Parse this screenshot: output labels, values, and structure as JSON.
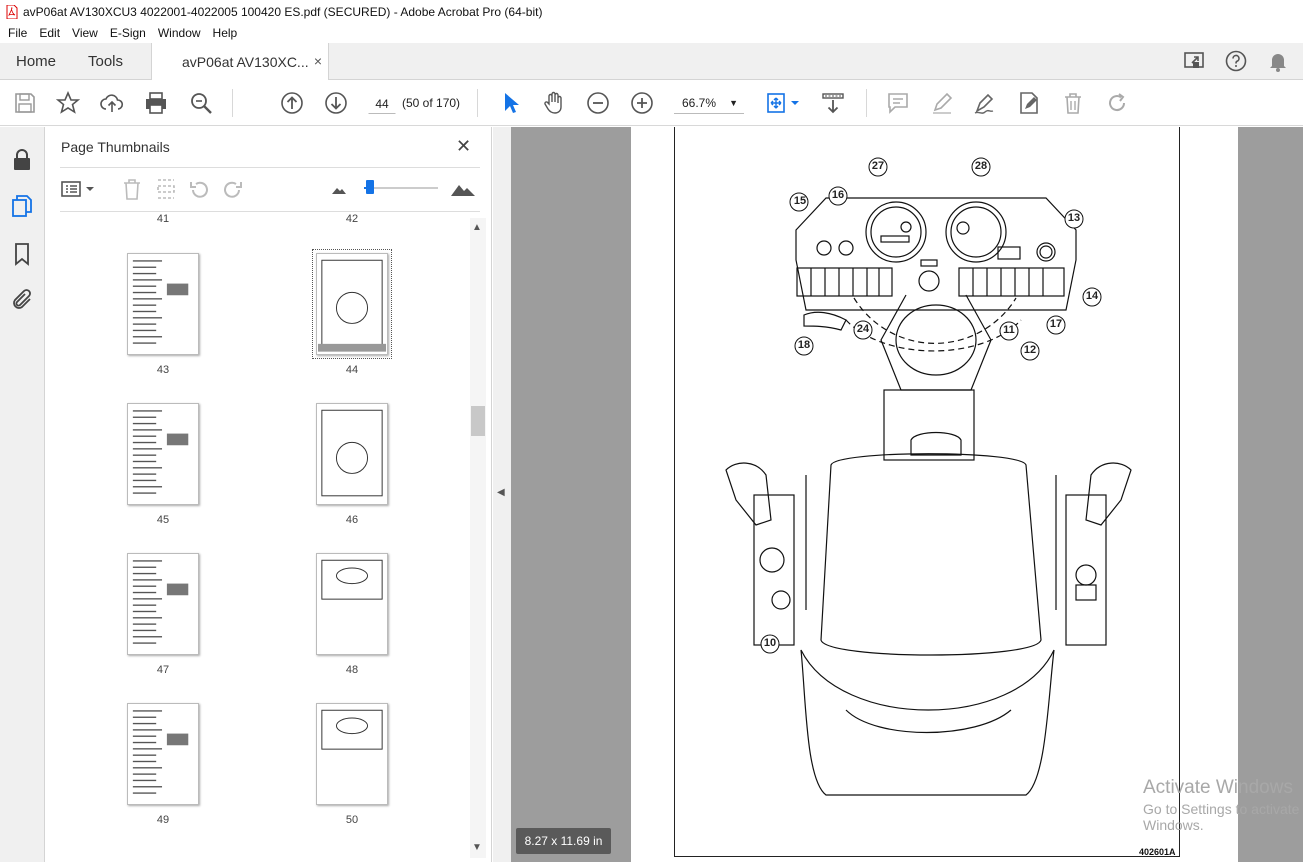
{
  "window": {
    "title": "avP06at AV130XCU3 4022001-4022005 100420 ES.pdf (SECURED) - Adobe Acrobat Pro (64-bit)"
  },
  "menu": [
    "File",
    "Edit",
    "View",
    "E-Sign",
    "Window",
    "Help"
  ],
  "tabs": {
    "home": "Home",
    "tools": "Tools",
    "document": "avP06at AV130XC...",
    "close": "×"
  },
  "toolbar": {
    "page_current": "44",
    "page_count": "(50 of 170)",
    "zoom": "66.7%"
  },
  "sidepanel": {
    "title": "Page Thumbnails",
    "close": "✕",
    "thumbnails": [
      {
        "label": "41"
      },
      {
        "label": "42"
      },
      {
        "label": "43"
      },
      {
        "label": "44",
        "selected": true
      },
      {
        "label": "45"
      },
      {
        "label": "46"
      },
      {
        "label": "47"
      },
      {
        "label": "48"
      },
      {
        "label": "49"
      },
      {
        "label": "50"
      }
    ]
  },
  "document": {
    "figure_id": "402601A",
    "callouts": [
      "15",
      "16",
      "27",
      "28",
      "13",
      "14",
      "17",
      "12",
      "11",
      "24",
      "18",
      "10"
    ],
    "page_size": "8.27 x 11.69 in"
  },
  "watermark": {
    "line1": "Activate Windows",
    "line2": "Go to Settings to activate Windows."
  },
  "colors": {
    "accent": "#1473e6",
    "viewer_bg": "#9d9d9d"
  }
}
